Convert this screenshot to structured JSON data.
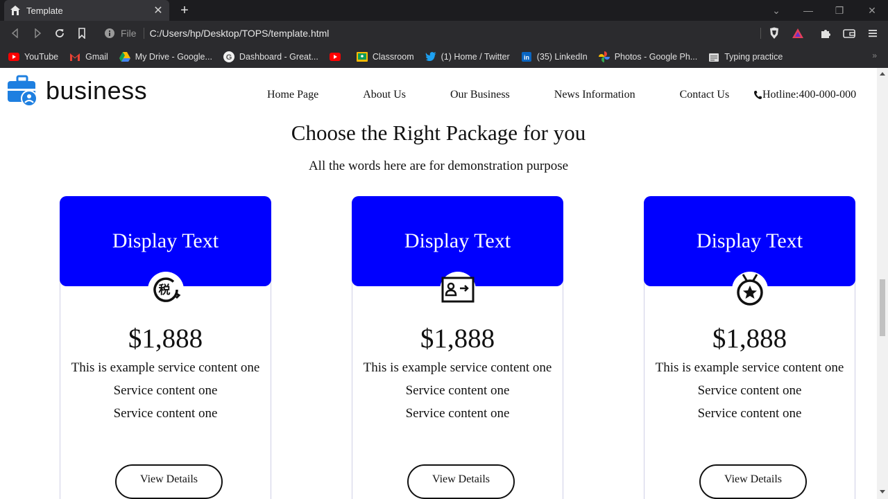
{
  "browser": {
    "tab_title": "Template",
    "url_scheme_label": "File",
    "url": "C:/Users/hp/Desktop/TOPS/template.html",
    "bookmarks": [
      {
        "label": "YouTube",
        "icon": "youtube-icon"
      },
      {
        "label": "Gmail",
        "icon": "gmail-icon"
      },
      {
        "label": "My Drive - Google...",
        "icon": "google-drive-icon"
      },
      {
        "label": "Dashboard - Great...",
        "icon": "google-icon"
      },
      {
        "label": "",
        "icon": "youtube-icon"
      },
      {
        "label": "Classroom",
        "icon": "classroom-icon"
      },
      {
        "label": "(1) Home / Twitter",
        "icon": "twitter-icon"
      },
      {
        "label": "(35) LinkedIn",
        "icon": "linkedin-icon"
      },
      {
        "label": "Photos - Google Ph...",
        "icon": "google-photos-icon"
      },
      {
        "label": "Typing practice",
        "icon": "typing-icon"
      }
    ],
    "more_bookmarks": "»"
  },
  "site": {
    "logo_text": "business",
    "nav": [
      {
        "label": "Home Page"
      },
      {
        "label": "About Us"
      },
      {
        "label": "Our Business"
      },
      {
        "label": "News Information"
      },
      {
        "label": "Contact Us"
      }
    ],
    "hotline": "Hotline:400-000-000"
  },
  "section": {
    "title": "Choose the Right Package for you",
    "subtitle": "All the words here are for demonstration purpose"
  },
  "cards": [
    {
      "head": "Display Text",
      "icon": "tax-refresh-icon",
      "price": "$1,888",
      "lines": [
        "This is example service content one",
        "Service content one",
        "Service content one"
      ],
      "button": "View Details"
    },
    {
      "head": "Display Text",
      "icon": "id-card-arrow-icon",
      "price": "$1,888",
      "lines": [
        "This is example service content one",
        "Service content one",
        "Service content one"
      ],
      "button": "View Details"
    },
    {
      "head": "Display Text",
      "icon": "medal-star-icon",
      "price": "$1,888",
      "lines": [
        "This is example service content one",
        "Service content one",
        "Service content one"
      ],
      "button": "View Details"
    }
  ],
  "colors": {
    "card_header": "#0000ff",
    "browser_tabbar": "#1c1c1f",
    "browser_toolbar": "#2b2b2e"
  }
}
